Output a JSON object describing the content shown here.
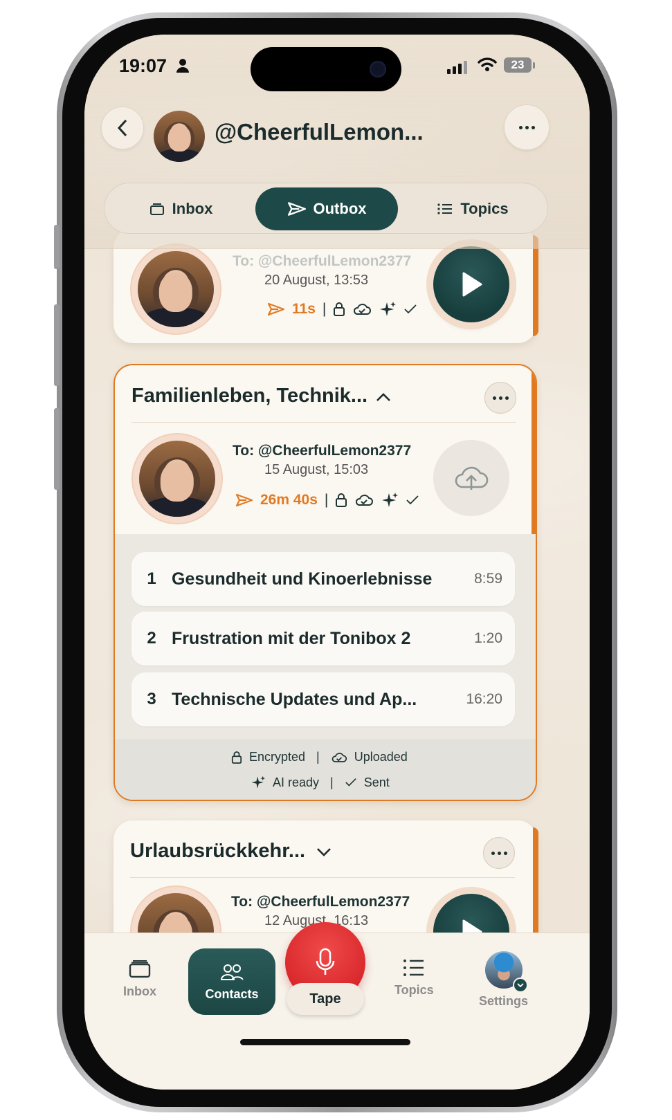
{
  "status_bar": {
    "time": "19:07",
    "battery": "23"
  },
  "header": {
    "contact_name": "@CheerfulLemon..."
  },
  "tabs": [
    {
      "label": "Inbox",
      "icon": "inbox-tray-icon"
    },
    {
      "label": "Outbox",
      "icon": "send-icon",
      "active": true
    },
    {
      "label": "Topics",
      "icon": "list-icon"
    }
  ],
  "messages": [
    {
      "to": "To: @CheerfulLemon2377",
      "date": "20 August, 13:53",
      "duration": "11s",
      "action": "play"
    },
    {
      "title": "Familienleben, Technik...",
      "expanded": true,
      "to": "To: @CheerfulLemon2377",
      "date": "15 August, 15:03",
      "duration": "26m 40s",
      "action": "upload",
      "topics": [
        {
          "num": "1",
          "title": "Gesundheit und Kinoerlebnisse",
          "time": "8:59"
        },
        {
          "num": "2",
          "title": "Frustration mit der Tonibox 2",
          "time": "1:20"
        },
        {
          "num": "3",
          "title": "Technische Updates und Ap...",
          "time": "16:20"
        }
      ],
      "status": {
        "encrypted": "Encrypted",
        "uploaded": "Uploaded",
        "ai": "AI ready",
        "sent": "Sent"
      }
    },
    {
      "title": "Urlaubsrückkehr...",
      "expanded": false,
      "to": "To: @CheerfulLemon2377",
      "date": "12 August, 16:13",
      "action": "play"
    }
  ],
  "bottom_nav": {
    "inbox": "Inbox",
    "contacts": "Contacts",
    "tape": "Tape",
    "topics": "Topics",
    "settings": "Settings"
  },
  "colors": {
    "accent": "#e07a22",
    "primary": "#1d4a48",
    "record": "#d8262a",
    "background": "#efe6da"
  }
}
